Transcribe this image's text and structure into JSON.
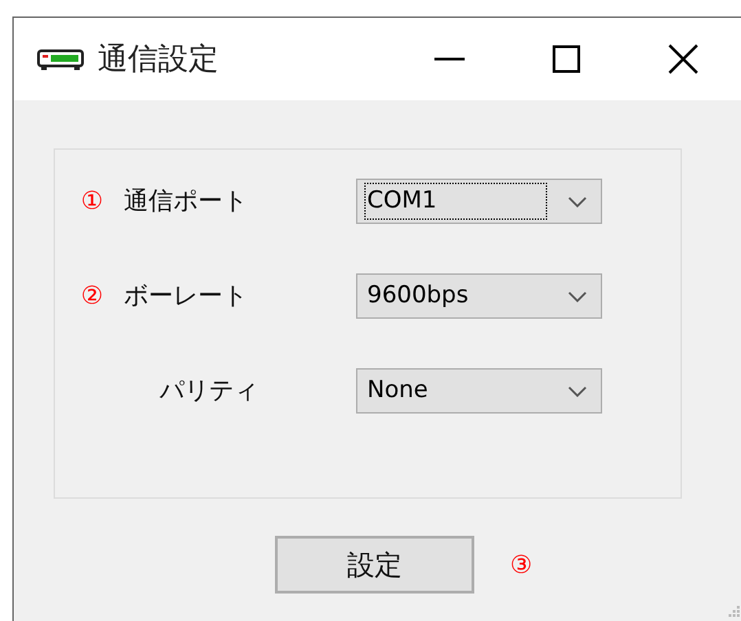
{
  "window": {
    "title": "通信設定",
    "controls": [
      {
        "kind": "minimize"
      },
      {
        "kind": "maximize"
      },
      {
        "kind": "close"
      }
    ]
  },
  "settings": [
    {
      "marker": "①",
      "label": "通信ポート",
      "value": "COM1",
      "focused": true
    },
    {
      "marker": "②",
      "label": "ボーレート",
      "value": "9600bps",
      "focused": false
    },
    {
      "label": "パリティ",
      "value": "None",
      "focused": false
    }
  ],
  "apply_button": {
    "label": "設定",
    "marker": "③"
  }
}
